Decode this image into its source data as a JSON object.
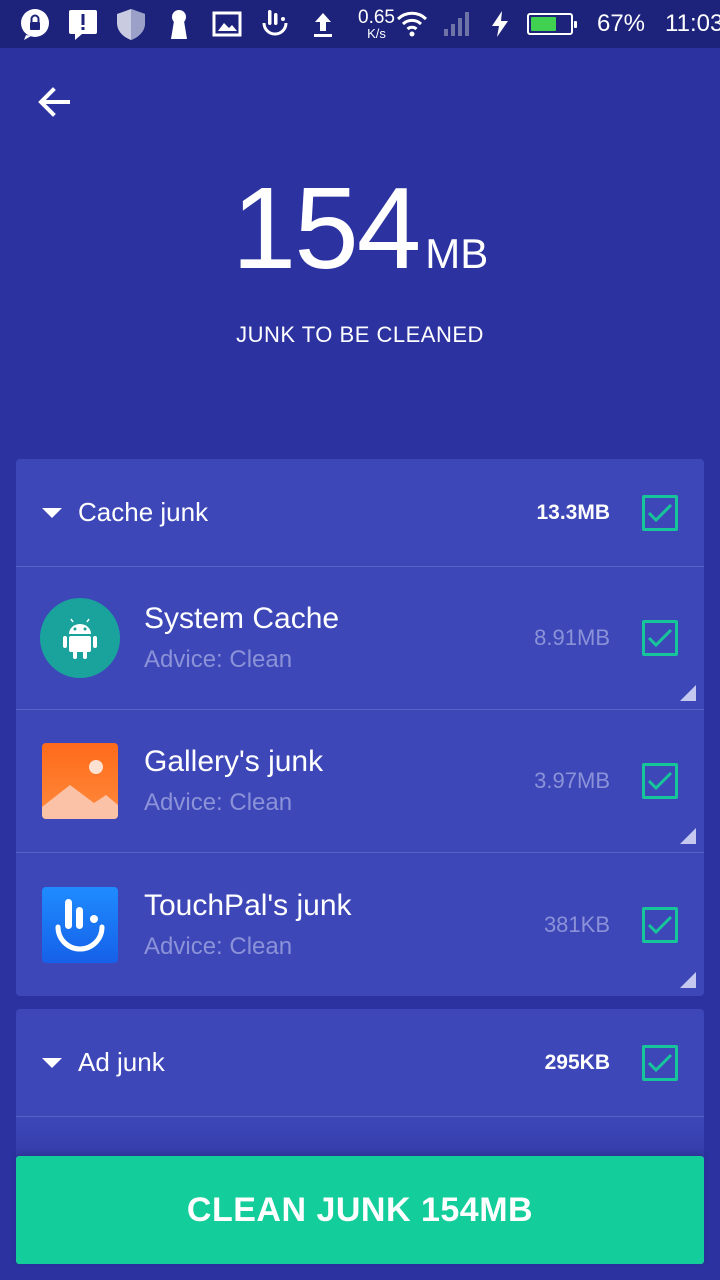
{
  "status_bar": {
    "speed_value": "0.65",
    "speed_unit": "K/s",
    "battery_percent_text": "67%",
    "battery_level": 0.67,
    "time": "11:03",
    "icons": [
      "lock-chat-icon",
      "alert-icon",
      "shield-icon",
      "keyhole-icon",
      "image-icon",
      "touchpal-icon",
      "upload-icon",
      "wifi-icon",
      "signal-icon",
      "charging-icon",
      "battery-icon"
    ]
  },
  "header": {
    "back_icon": "arrow-left-icon",
    "junk_amount": "154",
    "junk_unit": "MB",
    "subtitle": "JUNK TO BE CLEANED"
  },
  "categories": [
    {
      "label": "Cache junk",
      "size": "13.3MB",
      "checked": true,
      "items": [
        {
          "title": "System Cache",
          "advice": "Advice: Clean",
          "size": "8.91MB",
          "icon": "android-icon",
          "checked": true
        },
        {
          "title": "Gallery's junk",
          "advice": "Advice: Clean",
          "size": "3.97MB",
          "icon": "gallery-icon",
          "checked": true
        },
        {
          "title": "TouchPal's junk",
          "advice": "Advice: Clean",
          "size": "381KB",
          "icon": "touchpal-icon",
          "checked": true
        }
      ]
    },
    {
      "label": "Ad junk",
      "size": "295KB",
      "checked": true,
      "items": []
    }
  ],
  "clean_button": {
    "label": "CLEAN JUNK 154MB"
  },
  "colors": {
    "background": "#2c33a0",
    "statusbar": "#1d237a",
    "card": "#3d47b8",
    "accent": "#13cd9b",
    "check": "#17c59a"
  }
}
